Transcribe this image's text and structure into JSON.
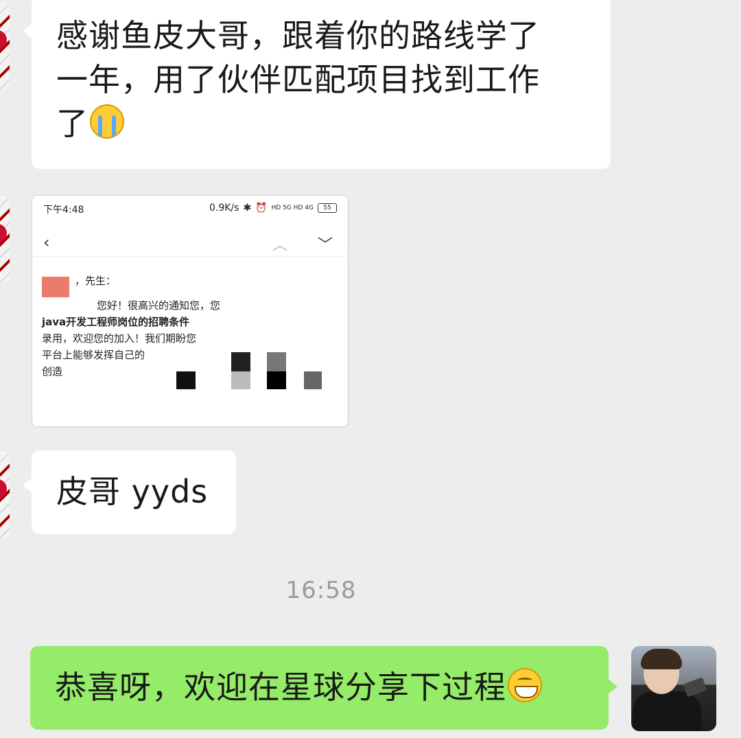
{
  "messages": {
    "m1": {
      "line1": "感谢鱼皮大哥，跟着你的路线学了",
      "line2": "一年，用了伙伴匹配项目找到工作",
      "line3": "了",
      "emoji": "crying-face-emoji"
    },
    "m3": {
      "text": "皮哥 yyds"
    },
    "m4": {
      "text": "恭喜呀，欢迎在星球分享下过程",
      "emoji": "grinning-face-emoji"
    }
  },
  "shot": {
    "status_time": "下午4:48",
    "status_net": "0.9K/s",
    "status_signal": "HD 5G HD 4G",
    "battery": "55",
    "greeting": "，先生：",
    "lines": [
      "您好！很高兴的通知您，您",
      "java开发工程师岗位的招聘条件",
      "录用，欢迎您的加入！我们期盼您",
      "平台上能够发挥自己的",
      "创造"
    ]
  },
  "timestamp": "16:58",
  "colors": {
    "background": "#ededed",
    "incoming": "#ffffff",
    "outgoing": "#95ec69"
  }
}
